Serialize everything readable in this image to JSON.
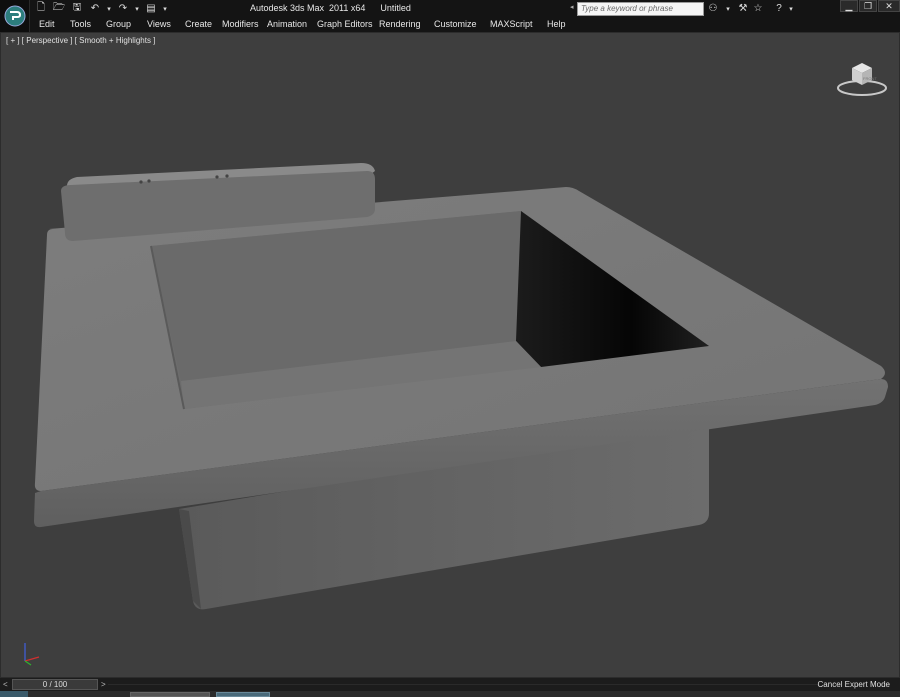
{
  "titlebar": {
    "app_name": "Autodesk 3ds Max  2011 x64",
    "doc_name": "Untitled",
    "search_placeholder": "Type a keyword or phrase"
  },
  "quick_access": {
    "icons": [
      "new-file-icon",
      "open-file-icon",
      "save-icon",
      "undo-icon",
      "undo-dropdown-icon",
      "redo-icon",
      "redo-dropdown-icon",
      "project-folder-icon",
      "quick-access-dropdown-icon"
    ]
  },
  "info_center": {
    "icons": [
      "binoculars-icon",
      "star-icon",
      "wrench-icon",
      "favorites-star-icon",
      "help-icon",
      "help-dropdown-icon"
    ]
  },
  "window_controls": {
    "minimize": "▁",
    "restore": "❐",
    "close": "✕"
  },
  "menu": {
    "items": [
      "Edit",
      "Tools",
      "Group",
      "Views",
      "Create",
      "Modifiers",
      "Animation",
      "Graph Editors",
      "Rendering",
      "Customize",
      "MAXScript",
      "Help"
    ]
  },
  "viewport": {
    "label": "[ + ] [ Perspective ] [ Smooth + Highlights ]",
    "viewcube_face": "FRONT"
  },
  "timeline": {
    "frame": "0 / 100",
    "prev": "<",
    "next": ">"
  },
  "status": {
    "cancel_expert": "Cancel Expert Mode"
  },
  "colors": {
    "viewport_bg": "#3e3e3e",
    "ui_dark": "#141414",
    "object_gray": "#7b7b7b"
  }
}
